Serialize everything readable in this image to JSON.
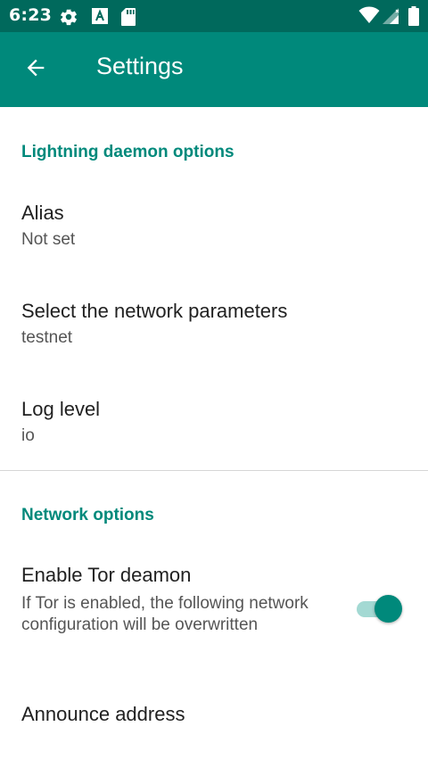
{
  "status_bar": {
    "time": "6:23",
    "icons": [
      "gear-icon",
      "app-notification-icon",
      "sd-card-icon",
      "wifi-icon",
      "cell-signal-icon",
      "battery-icon"
    ]
  },
  "app_bar": {
    "title": "Settings",
    "back_icon": "arrow-back-icon"
  },
  "sections": {
    "lightning": {
      "title": "Lightning daemon options",
      "alias": {
        "title": "Alias",
        "summary": "Not set"
      },
      "network": {
        "title": "Select the network parameters",
        "summary": "testnet"
      },
      "log_level": {
        "title": "Log level",
        "summary": "io"
      }
    },
    "network": {
      "title": "Network options",
      "tor": {
        "title": "Enable Tor deamon",
        "summary": "If Tor is enabled, the following network configuration will be overwritten",
        "enabled": true
      },
      "announce": {
        "title": "Announce address"
      }
    }
  },
  "colors": {
    "status_bar": "#00695c",
    "app_bar": "#00897b",
    "accent": "#00897b"
  }
}
